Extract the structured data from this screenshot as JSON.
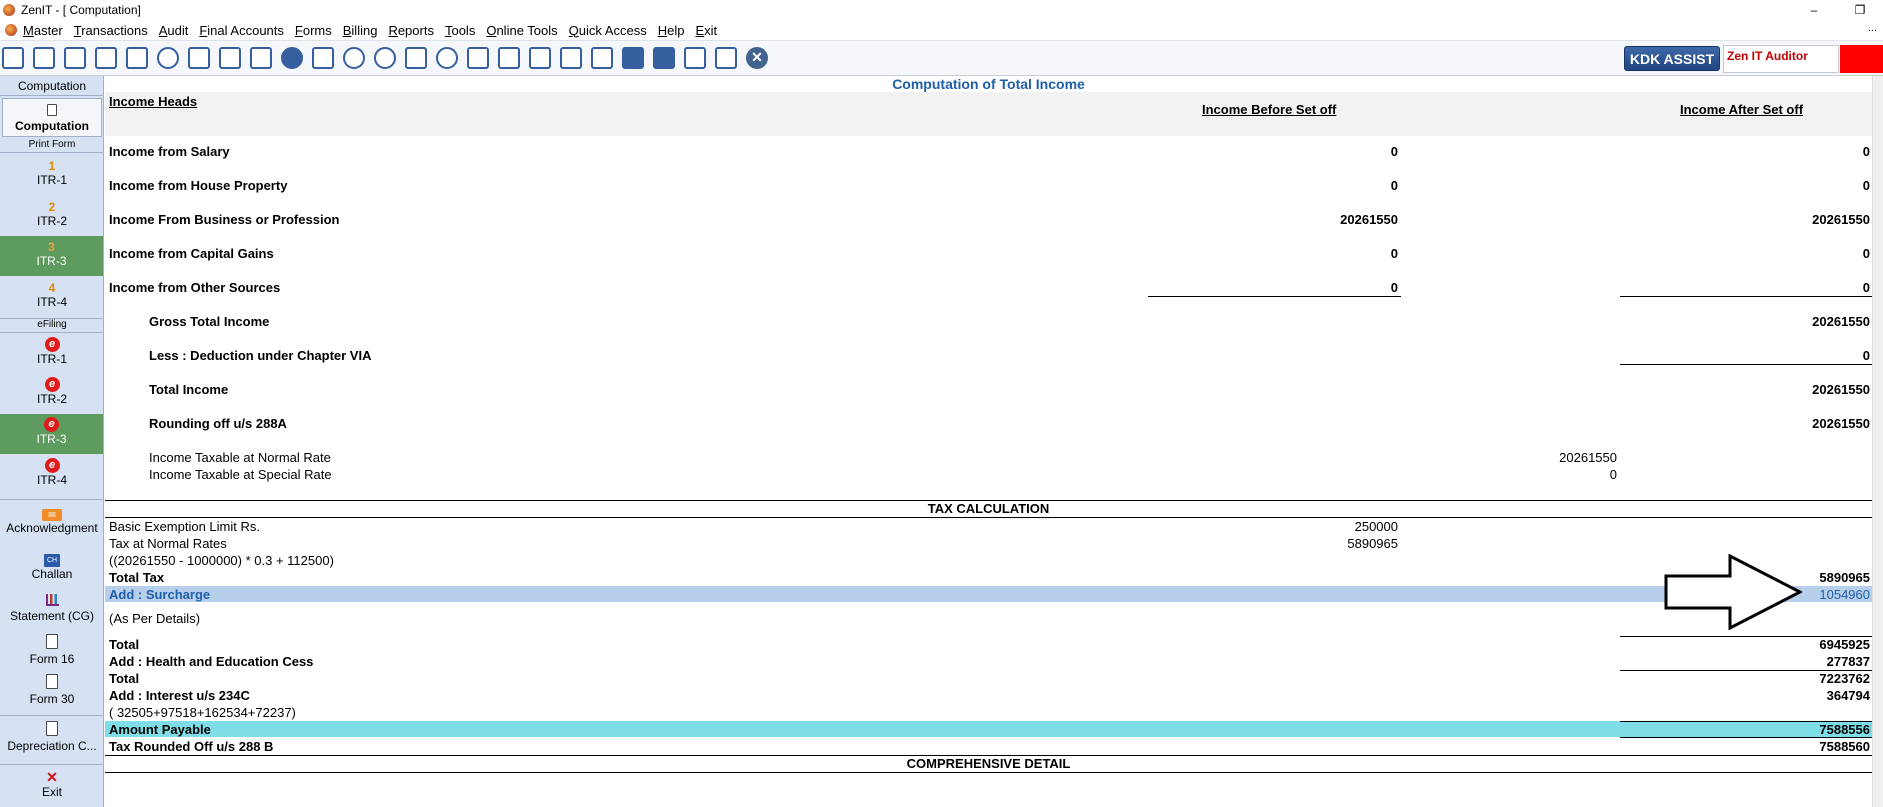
{
  "window": {
    "title": "ZenIT - [ Computation]",
    "minimize": "–",
    "restore": "❐"
  },
  "menu": [
    "Master",
    "Transactions",
    "Audit",
    "Final Accounts",
    "Forms",
    "Billing",
    "Reports",
    "Tools",
    "Online Tools",
    "Quick Access",
    "Help",
    "Exit"
  ],
  "menu_dots": "...",
  "toolbar": {
    "kdk_assist": "KDK ASSIST",
    "zen_auditor": "Zen IT Auditor",
    "close_symbol": "✕"
  },
  "sidebar": {
    "header": "Computation",
    "computation": "Computation",
    "print_form": "Print Form",
    "print_items": [
      {
        "num": "1",
        "label": "ITR-1"
      },
      {
        "num": "2",
        "label": "ITR-2"
      },
      {
        "num": "3",
        "label": "ITR-3"
      },
      {
        "num": "4",
        "label": "ITR-4"
      }
    ],
    "efiling": "eFiling",
    "efiling_items": [
      {
        "label": "ITR-1"
      },
      {
        "label": "ITR-2"
      },
      {
        "label": "ITR-3"
      },
      {
        "label": "ITR-4"
      }
    ],
    "e_glyph": "e",
    "ack_glyph": "✉",
    "challan_glyph": "CH",
    "acknowledgment": "Acknowledgment",
    "challan": "Challan",
    "statement_cg": "Statement (CG)",
    "form16": "Form 16",
    "form30": "Form 30",
    "depreciation": "Depreciation C...",
    "exit_icon": "✕",
    "exit": "Exit"
  },
  "computation": {
    "title": "Computation of Total Income",
    "income_heads": "Income Heads",
    "col_before": "Income Before Set off",
    "col_after": "Income After Set off",
    "rows": [
      {
        "label": "Income from Salary",
        "before": "0",
        "after": "0"
      },
      {
        "label": "Income from House Property",
        "before": "0",
        "after": "0"
      },
      {
        "label": "Income From Business or Profession",
        "before": "20261550",
        "after": "20261550"
      },
      {
        "label": "Income from Capital Gains",
        "before": "0",
        "after": "0"
      },
      {
        "label": "Income from Other Sources",
        "before": "0",
        "after": "0"
      }
    ],
    "gross_total_label": "Gross Total Income",
    "gross_total": "20261550",
    "deduction_label": "Less : Deduction under Chapter VIA",
    "deduction": "0",
    "total_income_label": "Total Income",
    "total_income": "20261550",
    "rounding_label": "Rounding off u/s 288A",
    "rounding": "20261550",
    "normal_rate_label": "Income Taxable at Normal Rate",
    "normal_rate": "20261550",
    "special_rate_label": "Income Taxable at Special Rate",
    "special_rate": "0"
  },
  "tax": {
    "section_title": "TAX CALCULATION",
    "exemption_label": "Basic Exemption Limit Rs.",
    "exemption": "250000",
    "normal_rates_label": "Tax at Normal Rates",
    "normal_rates": "5890965",
    "formula": "((20261550 - 1000000) * 0.3 + 112500)",
    "total_tax_label": "Total Tax",
    "total_tax": "5890965",
    "surcharge_label": "Add : Surcharge",
    "surcharge": "1054960",
    "as_per_details": "(As Per Details)",
    "total1_label": "Total",
    "total1": "6945925",
    "cess_label": "Add : Health and Education Cess",
    "cess": "277837",
    "total2_label": "Total",
    "total2": "7223762",
    "interest_label": "Add : Interest   u/s 234C",
    "interest": "364794",
    "interest_formula": "(  32505+97518+162534+72237)",
    "amount_payable_label": "Amount Payable",
    "amount_payable": "7588556",
    "rounded_label": "Tax Rounded Off u/s 288 B",
    "rounded": "7588560",
    "comprehensive": "COMPREHENSIVE DETAIL"
  },
  "colors": {
    "accent_blue": "#1f5ea8",
    "surcharge_band": "#b8cfec",
    "payable_band": "#7fdde8",
    "sidebar_bg": "#d6e2f3",
    "sidebar_active": "#5e9b5e",
    "red": "#ff0000"
  }
}
